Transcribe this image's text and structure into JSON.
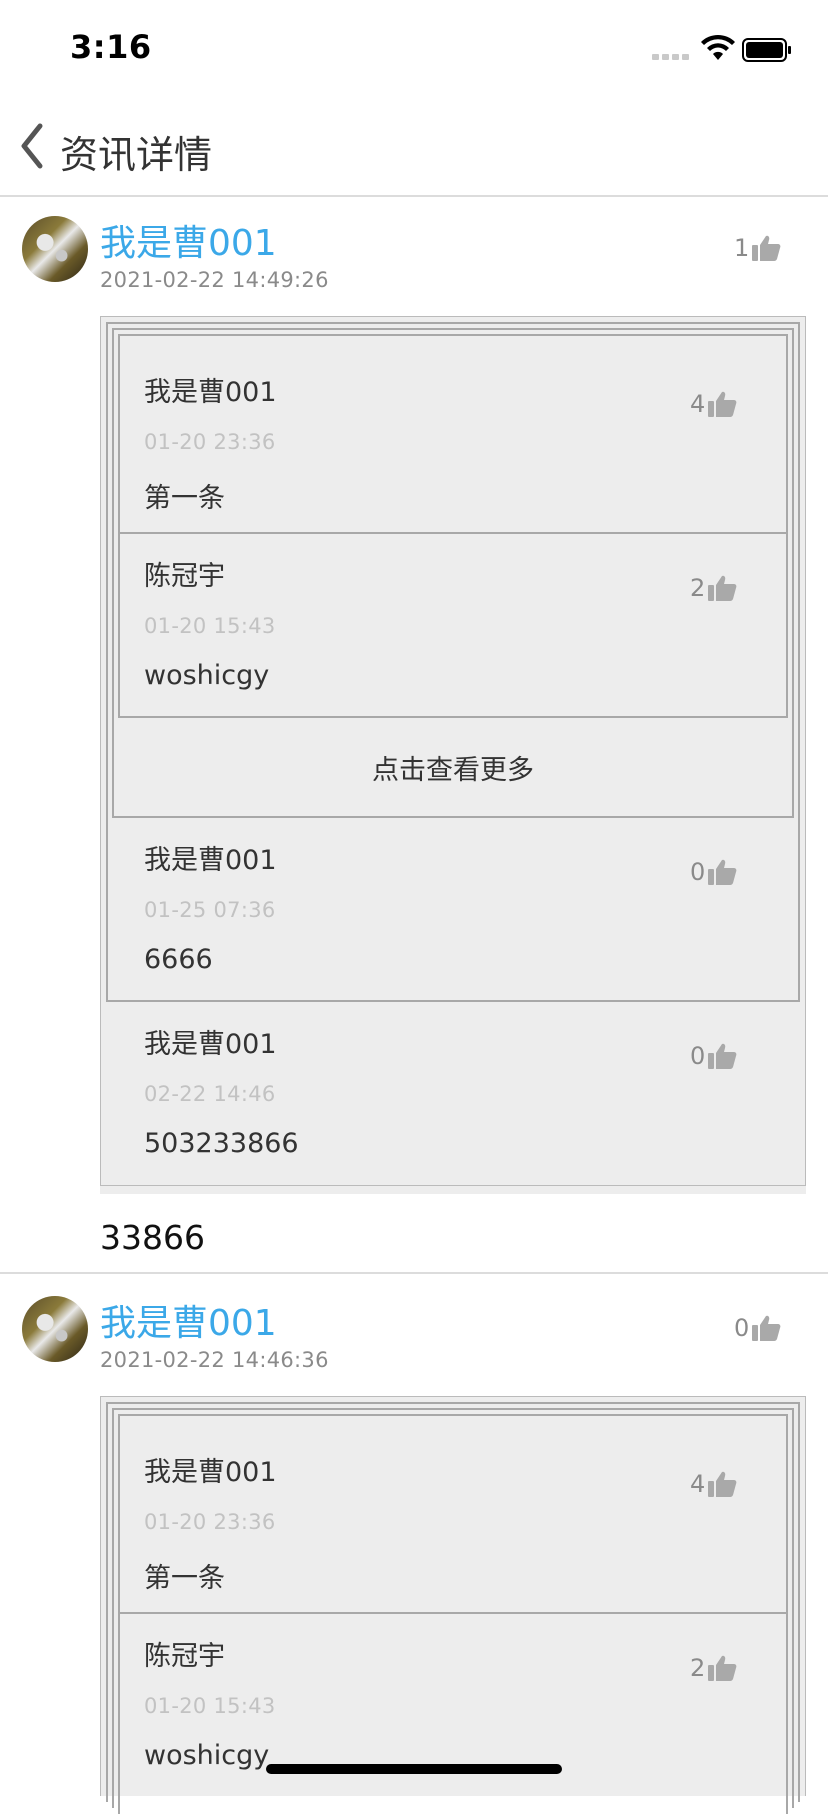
{
  "status_bar": {
    "time": "3:16"
  },
  "nav": {
    "title": "资讯详情"
  },
  "posts": [
    {
      "author": "我是曹001",
      "time": "2021-02-22 14:49:26",
      "likes": "1",
      "content": "33866",
      "thread": [
        {
          "name": "我是曹001",
          "time": "01-20 23:36",
          "text": "第一条",
          "likes": "4"
        },
        {
          "name": "陈冠宇",
          "time": "01-20 15:43",
          "text": "woshicgy",
          "likes": "2"
        },
        {
          "name": "我是曹001",
          "time": "01-25 07:36",
          "text": "6666",
          "likes": "0"
        },
        {
          "name": "我是曹001",
          "time": "02-22 14:46",
          "text": "503233866",
          "likes": "0"
        }
      ],
      "more_label": "点击查看更多"
    },
    {
      "author": "我是曹001",
      "time": "2021-02-22 14:46:36",
      "likes": "0",
      "thread": [
        {
          "name": "我是曹001",
          "time": "01-20 23:36",
          "text": "第一条",
          "likes": "4"
        },
        {
          "name": "陈冠宇",
          "time": "01-20 15:43",
          "text": "woshicgy",
          "likes": "2"
        }
      ]
    }
  ],
  "icons": {
    "back": "chevron-left-icon",
    "like": "thumbs-up-icon",
    "wifi": "wifi-icon",
    "battery": "battery-icon",
    "signal": "signal-icon"
  },
  "colors": {
    "author": "#3ba8e8",
    "quote_bg": "#ededed"
  }
}
